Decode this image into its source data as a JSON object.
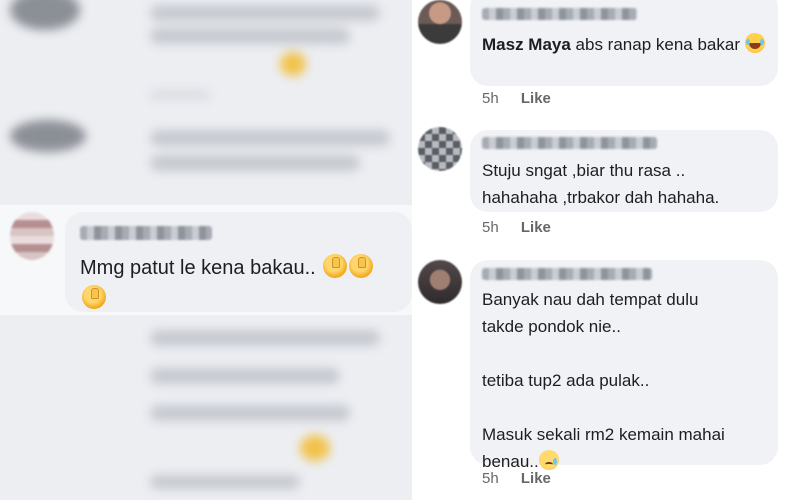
{
  "left_comment": {
    "text": "Mmg patut le kena bakau.. "
  },
  "comments": [
    {
      "mention": "Masz Maya",
      "text": " abs ranap kena bakar ",
      "time": "5h",
      "like_label": "Like"
    },
    {
      "text_lines": [
        "Stuju sngat ,biar thu rasa  ..",
        "hahahaha ,trbakor dah hahaha."
      ],
      "time": "5h",
      "like_label": "Like"
    },
    {
      "text_lines": [
        "Banyak nau dah tempat dulu",
        "takde pondok nie..",
        "tetiba tup2 ada pulak..",
        "Masuk sekali rm2 kemain mahai",
        "benau.."
      ],
      "time": "5h",
      "like_label": "Like"
    }
  ],
  "icons": {
    "thumb": "thumbs-up-emoji",
    "laugh": "tears-of-joy-emoji",
    "sad": "sad-tear-emoji"
  }
}
